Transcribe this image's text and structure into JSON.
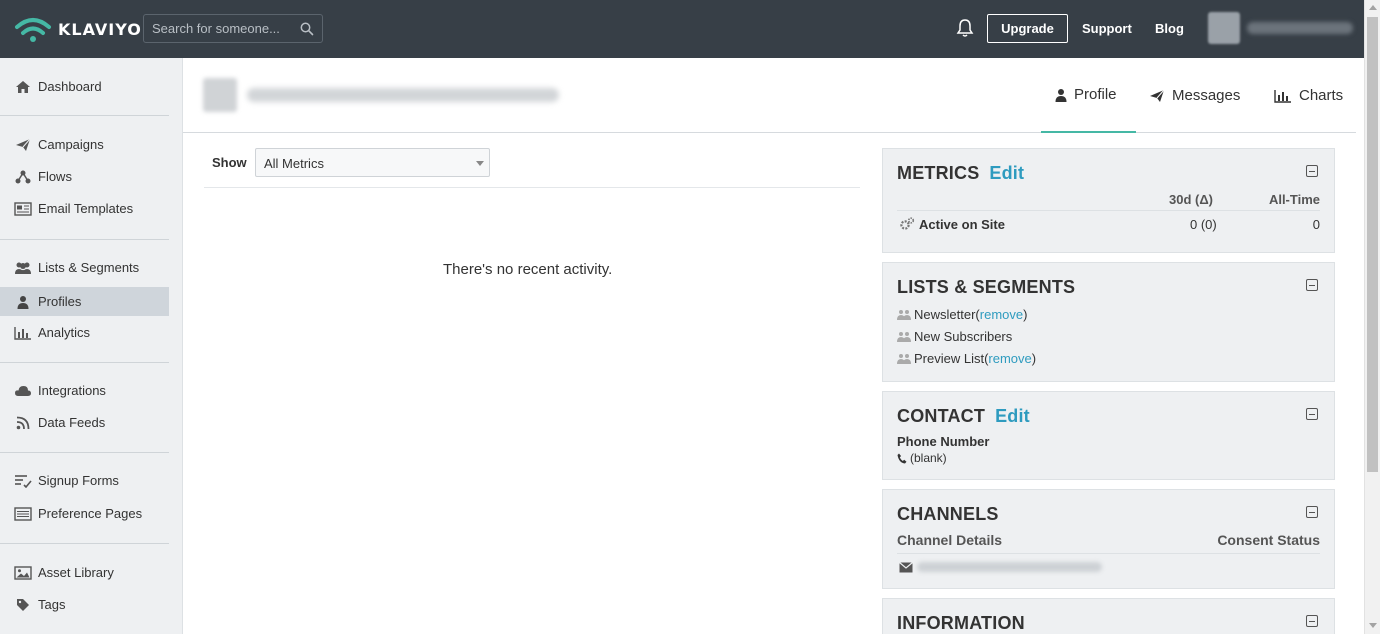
{
  "brand": {
    "name": "KLAVIYO",
    "accent": "#45b8a5",
    "link_color": "#2e9bbf",
    "topbar_color": "#373f47"
  },
  "topbar": {
    "search_placeholder": "Search for someone...",
    "upgrade_label": "Upgrade",
    "support_label": "Support",
    "blog_label": "Blog"
  },
  "sidebar": {
    "items": [
      {
        "label": "Dashboard",
        "icon": "home-icon"
      },
      {
        "label": "Campaigns",
        "icon": "paper-plane-icon"
      },
      {
        "label": "Flows",
        "icon": "flow-icon"
      },
      {
        "label": "Email Templates",
        "icon": "newspaper-icon"
      },
      {
        "label": "Lists & Segments",
        "icon": "users-icon"
      },
      {
        "label": "Profiles",
        "icon": "user-icon",
        "active": true
      },
      {
        "label": "Analytics",
        "icon": "bar-chart-icon"
      },
      {
        "label": "Integrations",
        "icon": "cloud-icon"
      },
      {
        "label": "Data Feeds",
        "icon": "rss-icon"
      },
      {
        "label": "Signup Forms",
        "icon": "list-icon"
      },
      {
        "label": "Preference Pages",
        "icon": "list-alt-icon"
      },
      {
        "label": "Asset Library",
        "icon": "image-icon"
      },
      {
        "label": "Tags",
        "icon": "tag-icon"
      }
    ]
  },
  "tabs": [
    {
      "label": "Profile",
      "icon": "user-icon",
      "active": true
    },
    {
      "label": "Messages",
      "icon": "paper-plane-icon"
    },
    {
      "label": "Charts",
      "icon": "bar-chart-icon"
    }
  ],
  "main": {
    "show_label": "Show",
    "metric_filter_value": "All Metrics",
    "empty_message": "There's no recent activity."
  },
  "metrics_panel": {
    "title": "METRICS",
    "edit_label": "Edit",
    "col_30d": "30d (Δ)",
    "col_all_time": "All-Time",
    "rows": [
      {
        "name": "Active on Site",
        "value_30d": "0 (0)",
        "all_time": "0"
      }
    ]
  },
  "lists_panel": {
    "title": "LISTS & SEGMENTS",
    "items": [
      {
        "name": "Newsletter",
        "prefix": " (",
        "action": "remove",
        "suffix": ")"
      },
      {
        "name": "New Subscribers",
        "prefix": "",
        "action": "",
        "suffix": ""
      },
      {
        "name": "Preview List",
        "prefix": " (",
        "action": "remove",
        "suffix": ")"
      }
    ]
  },
  "contact_panel": {
    "title": "CONTACT",
    "edit_label": "Edit",
    "phone_label": "Phone Number",
    "phone_value": "(blank)"
  },
  "channels_panel": {
    "title": "CHANNELS",
    "col_details": "Channel Details",
    "col_consent": "Consent Status"
  },
  "information_panel": {
    "title": "INFORMATION"
  }
}
